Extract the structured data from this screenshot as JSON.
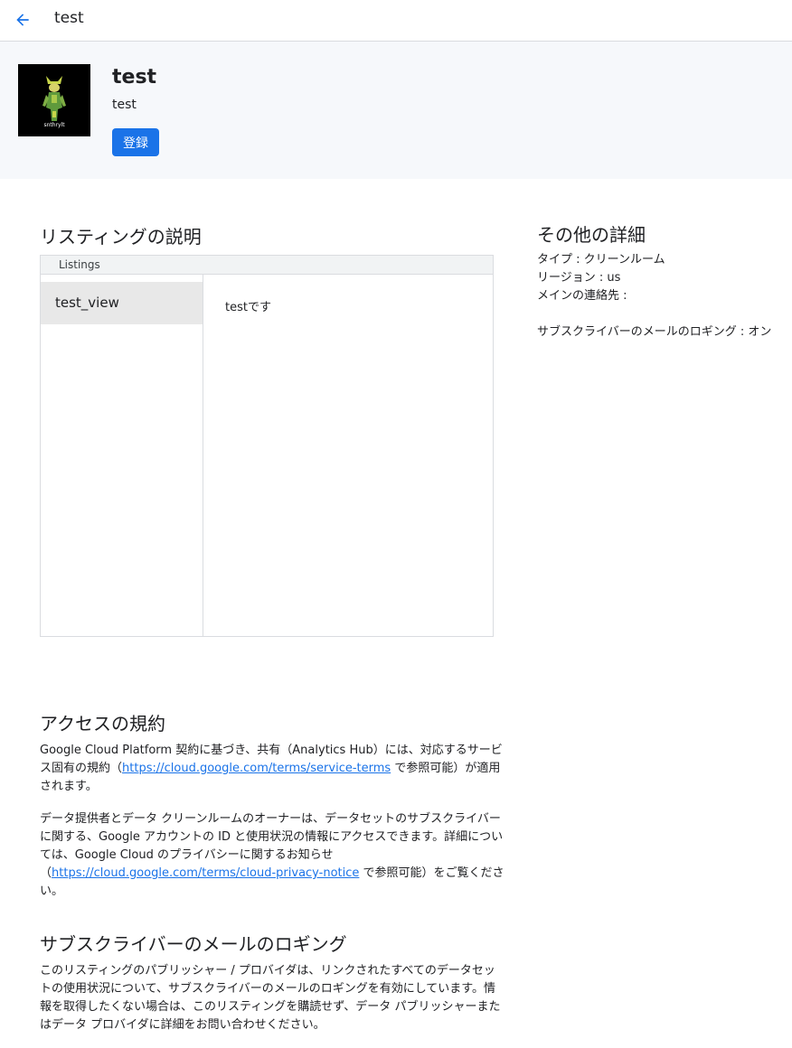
{
  "topbar": {
    "title": "test"
  },
  "hero": {
    "name": "test",
    "subtitle": "test",
    "subscribe_label": "登録",
    "logo_text": "snthrylt"
  },
  "description": {
    "heading": "リスティングの説明",
    "listings_header": "Listings",
    "selected_listing": "test_view",
    "content": "testです"
  },
  "details": {
    "heading": "その他の詳細",
    "type": "タイプ : クリーンルーム",
    "region": "リージョン : us",
    "contact": "メインの連絡先 :",
    "email_logging": "サブスクライバーのメールのロギング : オン"
  },
  "terms": {
    "heading": "アクセスの規約",
    "p1_before": "Google Cloud Platform 契約に基づき、共有（Analytics Hub）には、対応するサービス固有の規約（",
    "p1_link": "https://cloud.google.com/terms/service-terms",
    "p1_after": " で参照可能）が適用されます。",
    "p2_before": "データ提供者とデータ クリーンルームのオーナーは、データセットのサブスクライバーに関する、Google アカウントの ID と使用状況の情報にアクセスできます。詳細については、Google Cloud のプライバシーに関するお知らせ（",
    "p2_link": "https://cloud.google.com/terms/cloud-privacy-notice",
    "p2_after": " で参照可能）をご覧ください。"
  },
  "email_logging": {
    "heading": "サブスクライバーのメールのロギング",
    "paragraph": "このリスティングのパブリッシャー / プロバイダは、リンクされたすべてのデータセットの使用状況について、サブスクライバーのメールのロギングを有効にしています。情報を取得したくない場合は、このリスティングを購読せず、データ パブリッシャーまたはデータ プロバイダに詳細をお問い合わせください。"
  },
  "colors": {
    "accent": "#1a73e8",
    "hero_bg": "#f6f8fb",
    "selected_bg": "#e8e8e8"
  }
}
